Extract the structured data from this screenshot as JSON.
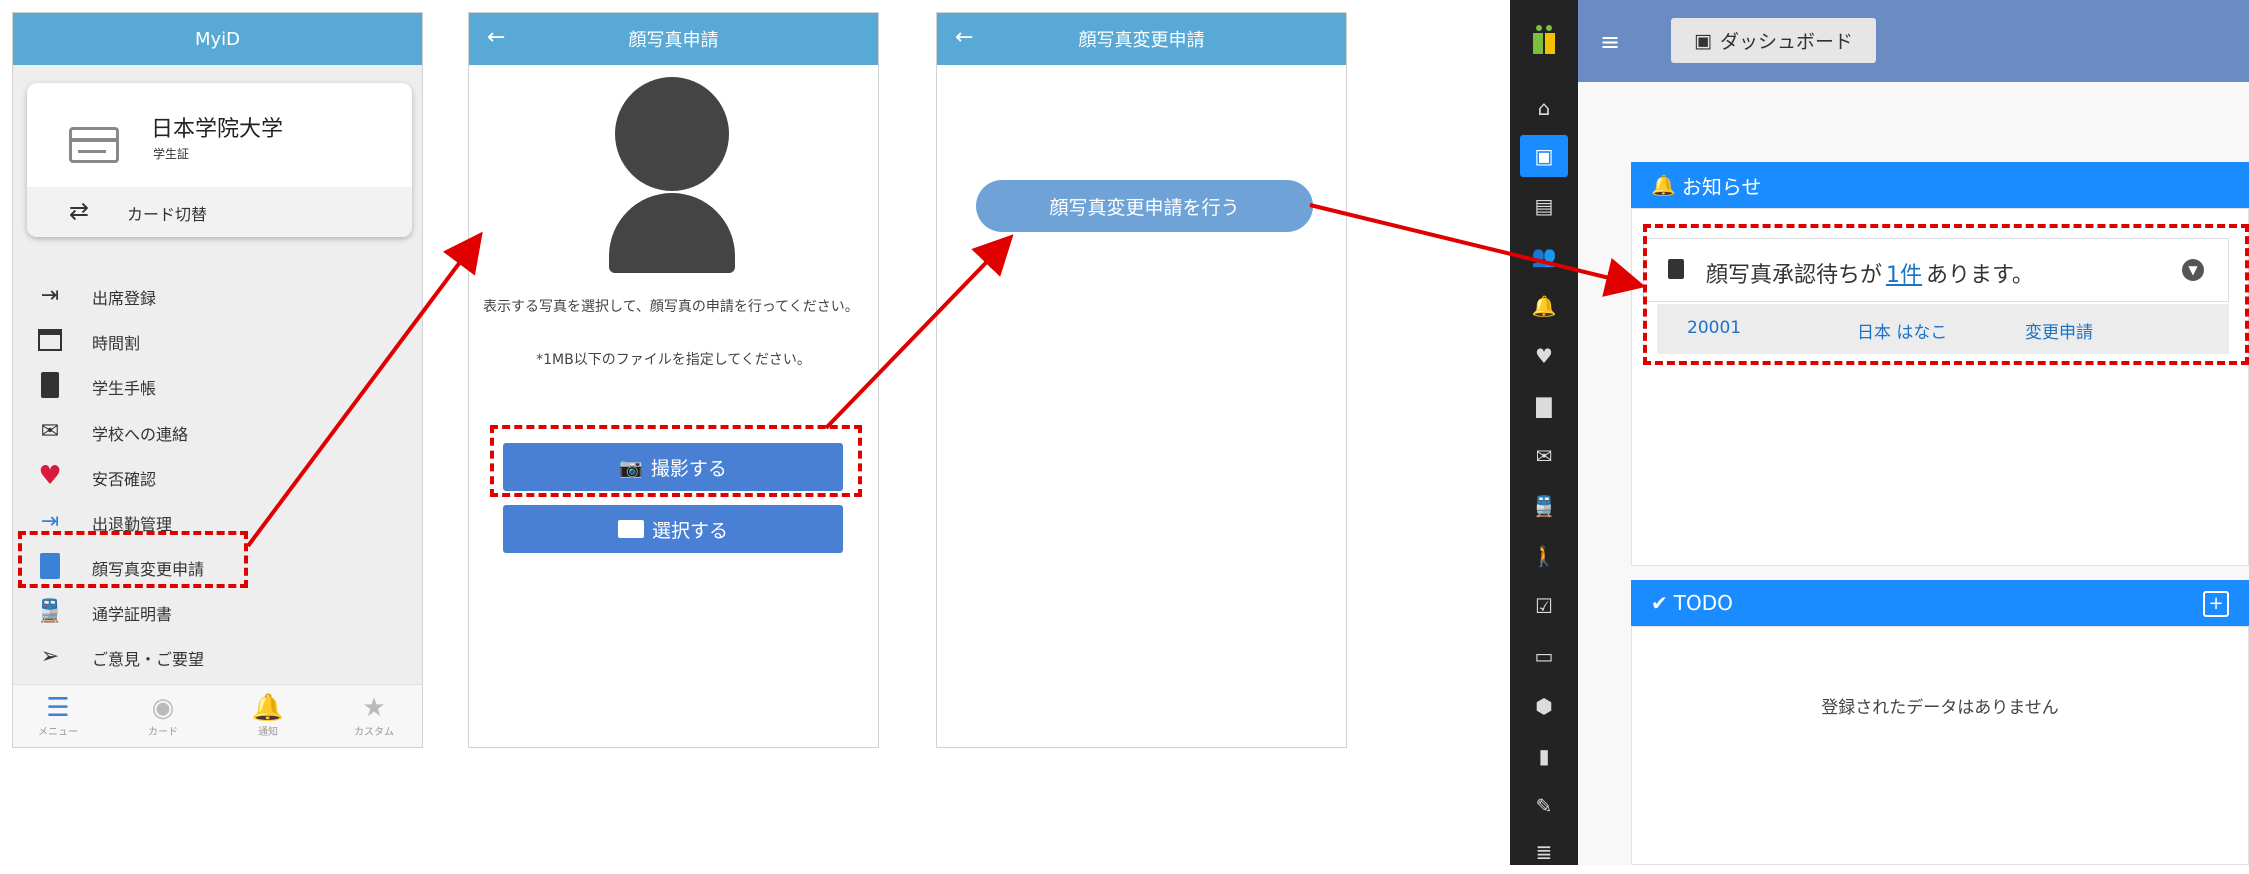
{
  "screen1": {
    "title": "MyiD",
    "card": {
      "name": "日本学院大学",
      "sub": "学生証",
      "switch_label": "カード切替"
    },
    "menu": [
      {
        "label": "出席登録",
        "icon": "sign-in-icon"
      },
      {
        "label": "時間割",
        "icon": "calendar-grid-icon"
      },
      {
        "label": "学生手帳",
        "icon": "notebook-icon"
      },
      {
        "label": "学校への連絡",
        "icon": "envelope-icon"
      },
      {
        "label": "安否確認",
        "icon": "heart-icon"
      },
      {
        "label": "出退勤管理",
        "icon": "sign-in-icon"
      },
      {
        "label": "顔写真変更申請",
        "icon": "id-badge-icon"
      },
      {
        "label": "通学証明書",
        "icon": "train-icon"
      },
      {
        "label": "ご意見・ご要望",
        "icon": "paper-plane-icon"
      }
    ],
    "bottom_nav": [
      {
        "label": "メニュー",
        "icon": "menu-icon"
      },
      {
        "label": "カード",
        "icon": "user-circle-icon"
      },
      {
        "label": "通知",
        "icon": "bell-icon"
      },
      {
        "label": "カスタム",
        "icon": "star-icon"
      }
    ]
  },
  "screen2": {
    "back": "←",
    "title": "顔写真申請",
    "description": "表示する写真を選択して、顔写真の申請を行ってください。",
    "note": "*1MB以下のファイルを指定してください。",
    "take_photo": "撮影する",
    "select_photo": "選択する"
  },
  "screen3": {
    "back": "←",
    "title": "顔写真変更申請",
    "action": "顔写真変更申請を行う"
  },
  "dashboard": {
    "tab_label": "ダッシュボード",
    "notice": {
      "header": "お知らせ",
      "message_before": "顔写真承認待ちが",
      "link": "1件",
      "message_after": "あります。",
      "row": {
        "id": "20001",
        "name": "日本 はなこ",
        "type": "変更申請"
      }
    },
    "todo": {
      "header": "TODO",
      "add": "+",
      "empty": "登録されたデータはありません"
    },
    "sidebar_icons": [
      "home-icon",
      "dashboard-icon",
      "id-card-icon",
      "users-icon",
      "bell-icon",
      "heartbeat-icon",
      "book-icon",
      "envelope-icon",
      "train-icon",
      "walking-icon",
      "calendar-check-icon",
      "presentation-icon",
      "cube-icon",
      "clipboard-icon",
      "pencil-icon",
      "database-icon"
    ]
  },
  "colors": {
    "accent": "#1a8cff",
    "appbar": "#58a9d6",
    "highlight": "#e00000",
    "button": "#4a80d4"
  }
}
